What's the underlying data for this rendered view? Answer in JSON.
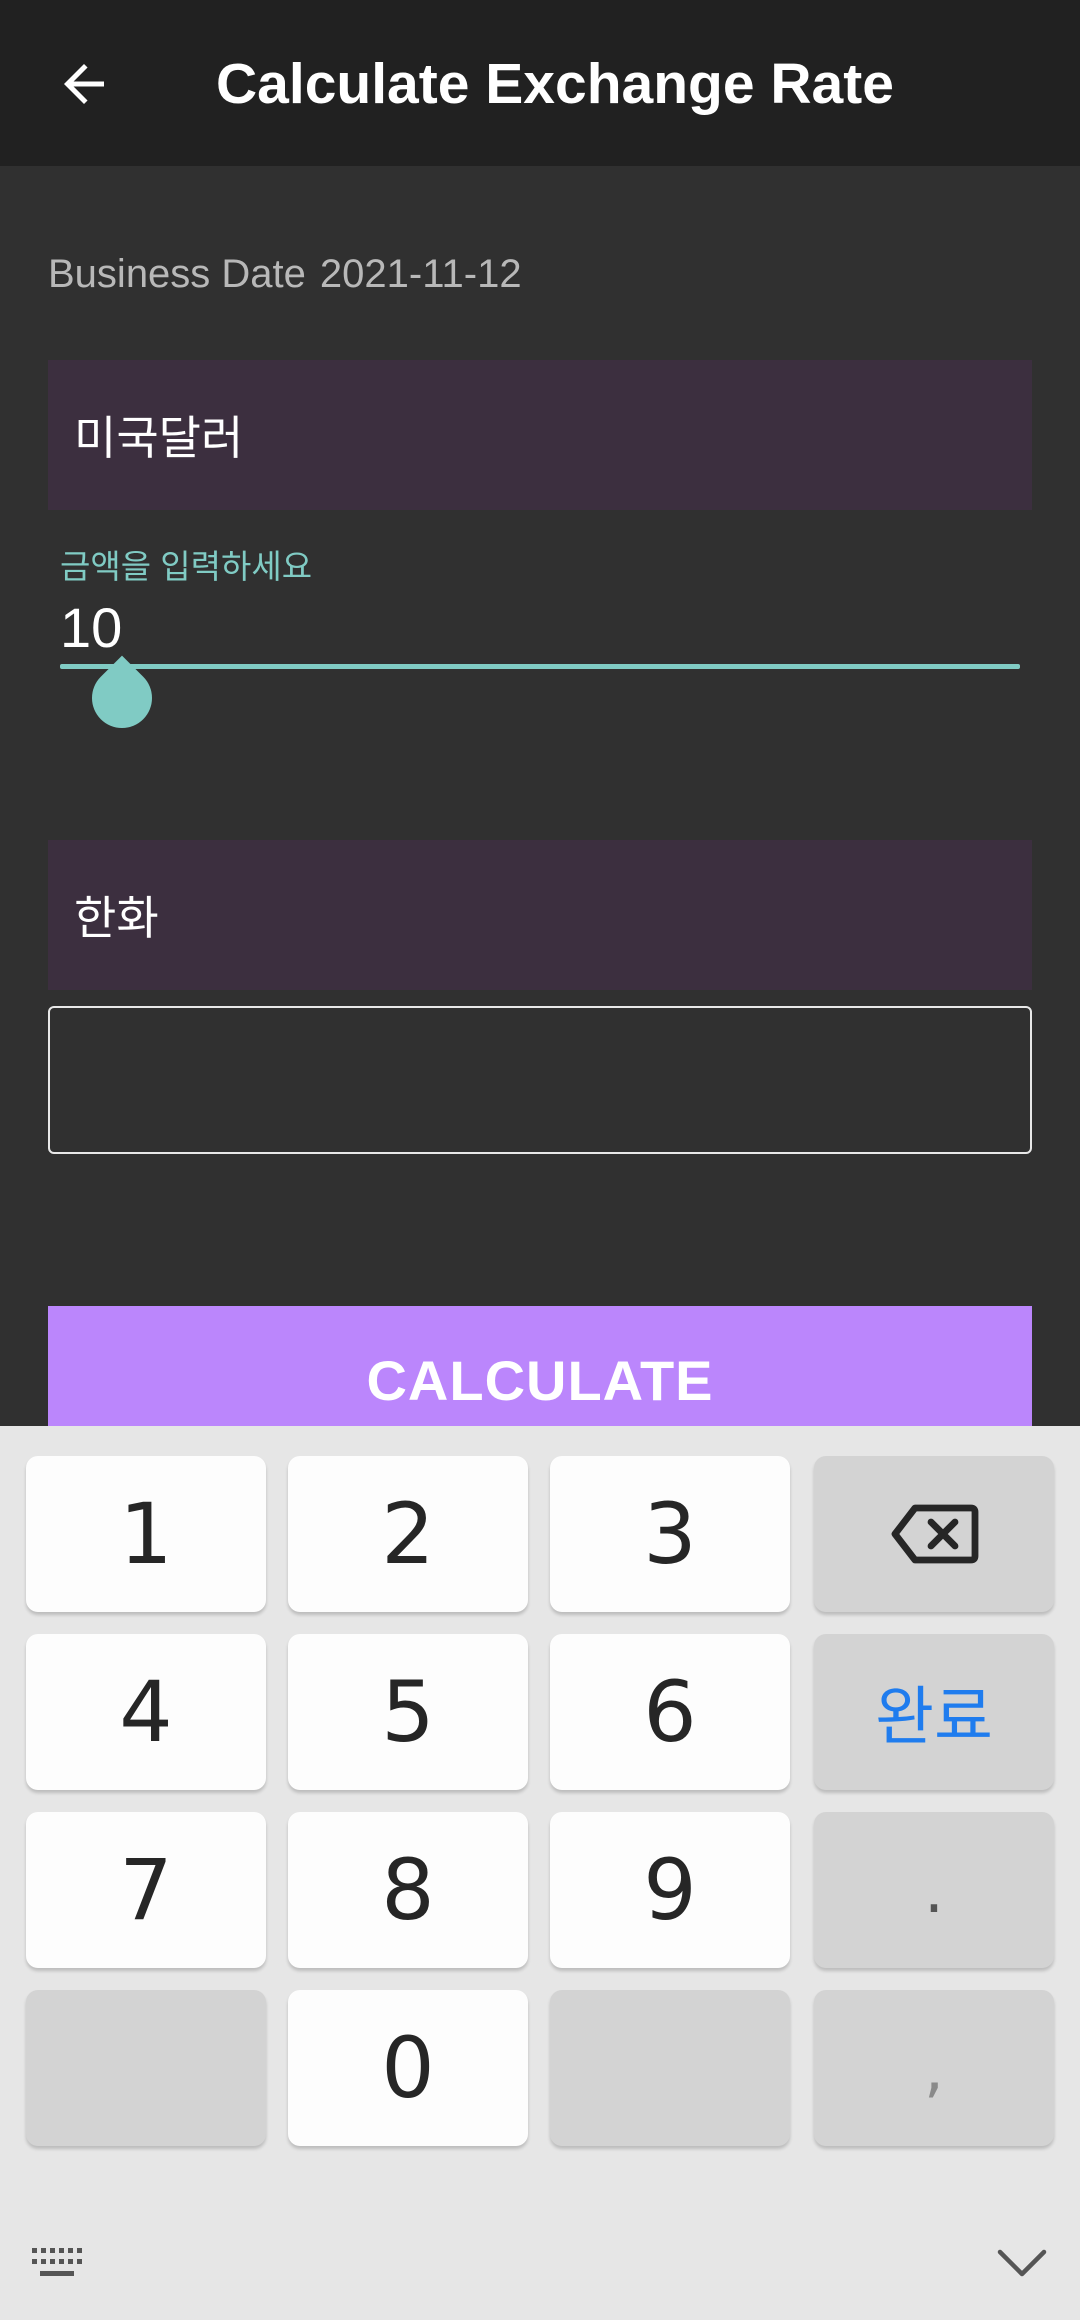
{
  "appbar": {
    "back_icon": "arrow-left-icon",
    "title": "Calculate Exchange Rate"
  },
  "business_date": {
    "label": "Business Date",
    "value": "2021-11-12"
  },
  "from_currency": "미국달러",
  "amount_field": {
    "label": "금액을 입력하세요",
    "value": "10",
    "accent_color": "#80cbc4"
  },
  "to_currency": "한화",
  "result_field": {
    "value": ""
  },
  "calculate_button": {
    "label": "CALCULATE",
    "color": "#bb86fc"
  },
  "keyboard": {
    "keys": {
      "k1": "1",
      "k2": "2",
      "k3": "3",
      "k4": "4",
      "k5": "5",
      "k6": "6",
      "k7": "7",
      "k8": "8",
      "k9": "9",
      "k0": "0",
      "done": "완료",
      "dot": ".",
      "comma": ","
    },
    "backspace_icon": "backspace-icon",
    "keyboard_switch_icon": "keyboard-icon",
    "hide_icon": "chevron-down-icon",
    "done_color": "#1f7cee"
  }
}
